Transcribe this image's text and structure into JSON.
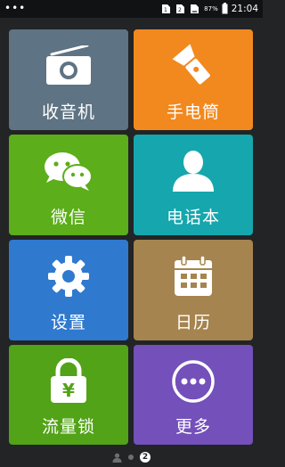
{
  "status_bar": {
    "menu_dots": "•••",
    "battery_percent": "87%",
    "time": "21:04",
    "icons": [
      "sim1-signal-icon",
      "sim2-signal-icon",
      "signal-icon",
      "battery-icon"
    ]
  },
  "tiles": [
    {
      "id": "radio",
      "label": "收音机",
      "icon": "radio-icon",
      "color": "#5e7383"
    },
    {
      "id": "flashlight",
      "label": "手电筒",
      "icon": "flashlight-icon",
      "color": "#f2891e"
    },
    {
      "id": "wechat",
      "label": "微信",
      "icon": "wechat-icon",
      "color": "#5cae1a"
    },
    {
      "id": "contacts",
      "label": "电话本",
      "icon": "contact-person-icon",
      "color": "#15a7ad"
    },
    {
      "id": "settings",
      "label": "设置",
      "icon": "gear-icon",
      "color": "#2f79cf"
    },
    {
      "id": "calendar",
      "label": "日历",
      "icon": "calendar-icon",
      "color": "#a5844f"
    },
    {
      "id": "traffic-lock",
      "label": "流量锁",
      "icon": "lock-yuan-icon",
      "color": "#52a317"
    },
    {
      "id": "more",
      "label": "更多",
      "icon": "more-dots-icon",
      "color": "#7350ba"
    }
  ],
  "pager": {
    "current_page": "2",
    "icons": [
      "home-person-icon",
      "page-dot"
    ]
  }
}
